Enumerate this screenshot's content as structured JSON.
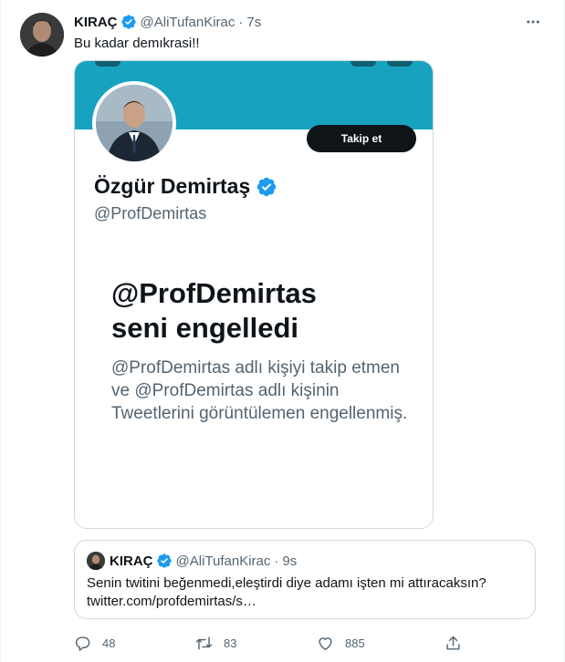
{
  "tweet": {
    "author_name": "KIRAÇ",
    "author_handle": "@AliTufanKirac",
    "dot": "·",
    "time": "7s",
    "text": "Bu kadar demıkrasi!!"
  },
  "media": {
    "profile_name": "Özgür Demirtaş",
    "profile_handle": "@ProfDemirtas",
    "follow_label": "Takip et",
    "blocked_title_line1": "@ProfDemirtas",
    "blocked_title_line2": "seni engelledi",
    "blocked_description": "@ProfDemirtas adlı kişiyi takip etmen ve @ProfDemirtas adlı kişinin Tweetlerini görüntülemen engellenmiş."
  },
  "quote": {
    "author_name": "KIRAÇ",
    "author_handle": "@AliTufanKirac",
    "dot": "·",
    "time": "9s",
    "text_line1": "Senin twitini beğenmedi,eleştirdi diye adamı işten mi attıracaksın?",
    "text_line2": "twitter.com/profdemirtas/s…"
  },
  "actions": {
    "replies": "48",
    "retweets": "83",
    "likes": "885"
  },
  "icons": {
    "verified": "verified-badge-icon",
    "more": "more-dots-icon",
    "reply": "reply-icon",
    "retweet": "retweet-icon",
    "like": "heart-icon",
    "share": "share-icon"
  },
  "colors": {
    "verified": "#1d9bf0",
    "banner": "#17a3bf",
    "secondary_text": "#536471",
    "border": "#cfd9de"
  }
}
